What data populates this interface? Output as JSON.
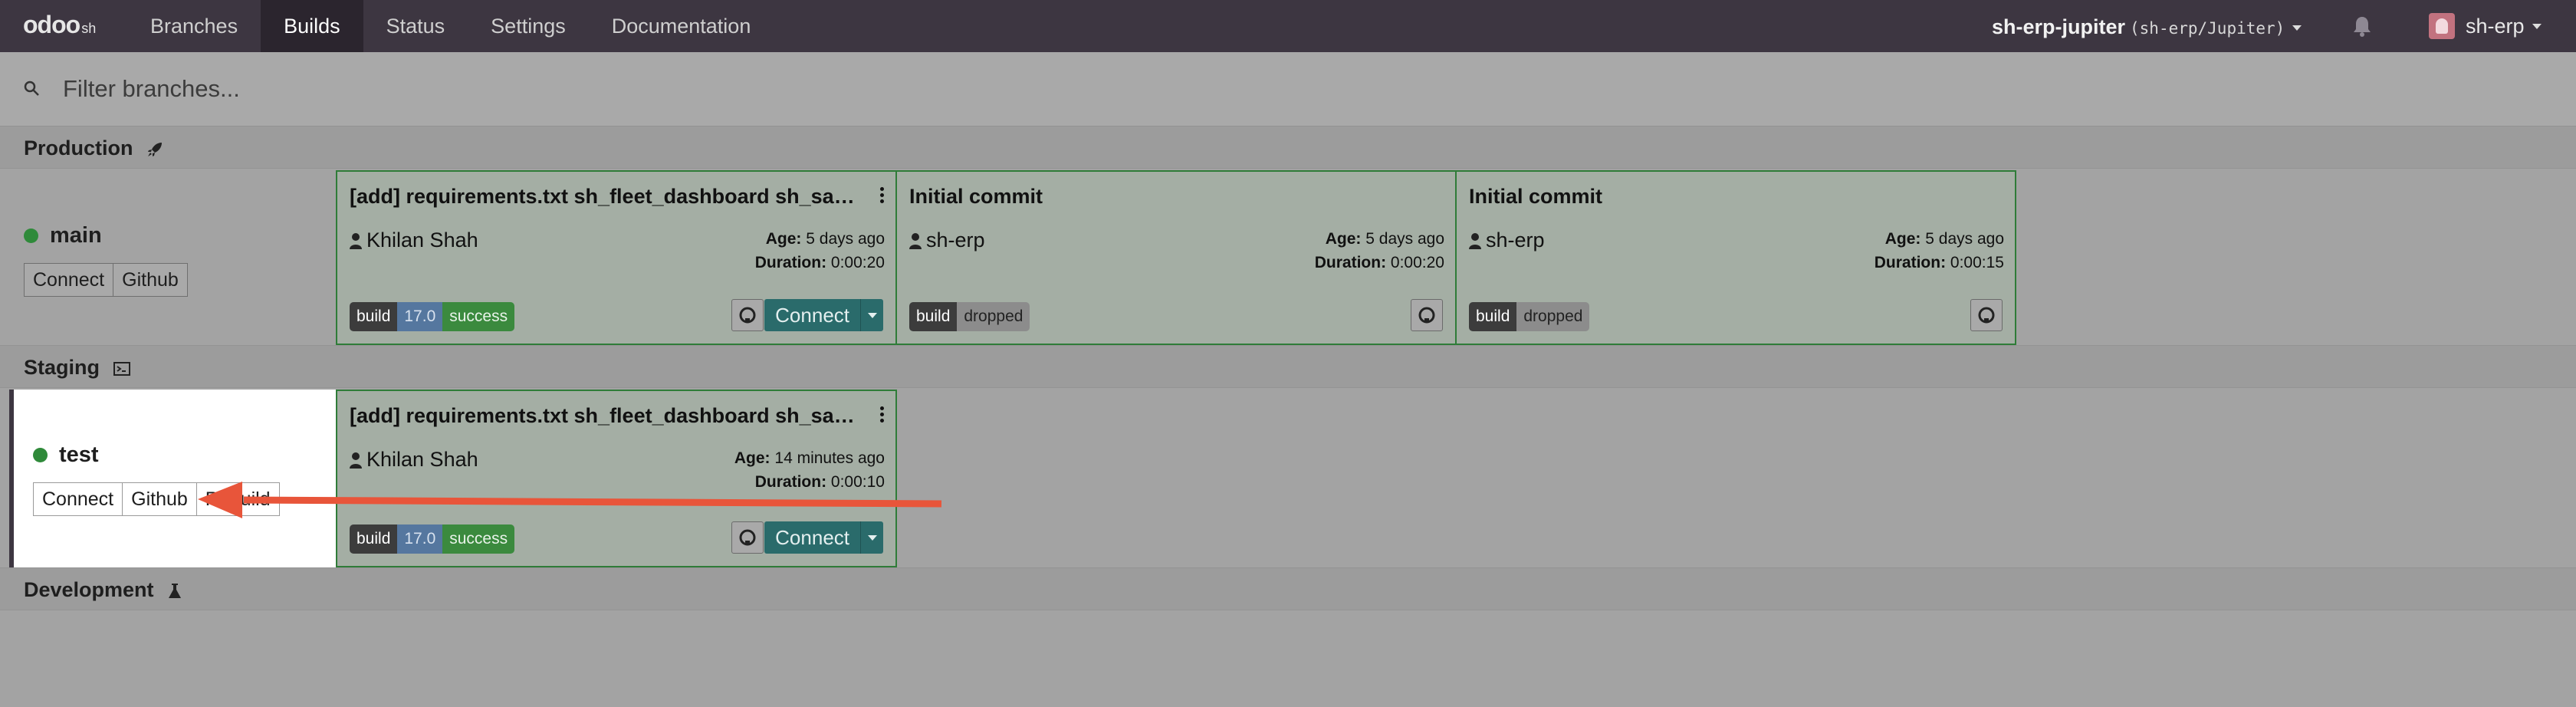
{
  "nav": {
    "logo_main": "odoo",
    "logo_suffix": "sh",
    "items": [
      {
        "label": "Branches",
        "active": false
      },
      {
        "label": "Builds",
        "active": true
      },
      {
        "label": "Status",
        "active": false
      },
      {
        "label": "Settings",
        "active": false
      },
      {
        "label": "Documentation",
        "active": false
      }
    ],
    "project_name": "sh-erp-jupiter",
    "project_repo": "(sh-erp/Jupiter)",
    "user_name": "sh-erp"
  },
  "filter": {
    "placeholder": "Filter branches..."
  },
  "stages": {
    "production": {
      "label": "Production",
      "icon": "rocket-icon",
      "branch": {
        "name": "main",
        "status_color": "#2f8a3a",
        "buttons": [
          "Connect",
          "Github"
        ]
      },
      "builds": [
        {
          "title": "[add] requirements.txt sh_fleet_dashboard sh_sale...",
          "author": "Khilan Shah",
          "age_label": "Age:",
          "age": "5 days ago",
          "duration_label": "Duration:",
          "duration": "0:00:20",
          "badges": [
            "build",
            "17.0",
            "success"
          ],
          "connect_label": "Connect"
        },
        {
          "title": "Initial commit",
          "author": "sh-erp",
          "age_label": "Age:",
          "age": "5 days ago",
          "duration_label": "Duration:",
          "duration": "0:00:20",
          "badges": [
            "build",
            "dropped"
          ]
        },
        {
          "title": "Initial commit",
          "author": "sh-erp",
          "age_label": "Age:",
          "age": "5 days ago",
          "duration_label": "Duration:",
          "duration": "0:00:15",
          "badges": [
            "build",
            "dropped"
          ]
        }
      ]
    },
    "staging": {
      "label": "Staging",
      "icon": "terminal-icon",
      "branch": {
        "name": "test",
        "status_color": "#2f8a3a",
        "buttons": [
          "Connect",
          "Github",
          "Rebuild"
        ]
      },
      "builds": [
        {
          "title": "[add] requirements.txt sh_fleet_dashboard sh_sale...",
          "author": "Khilan Shah",
          "age_label": "Age:",
          "age": "14 minutes ago",
          "duration_label": "Duration:",
          "duration": "0:00:10",
          "badges": [
            "build",
            "17.0",
            "success"
          ],
          "connect_label": "Connect"
        }
      ]
    },
    "development": {
      "label": "Development",
      "icon": "flask-icon"
    }
  },
  "annotation": {
    "arrow_color": "#e8553a"
  }
}
